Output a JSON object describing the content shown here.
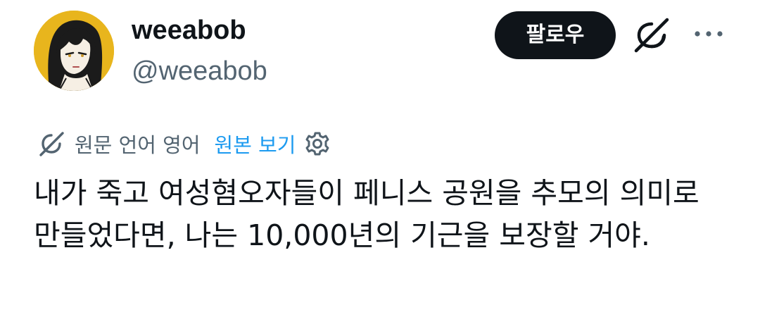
{
  "author": {
    "display_name": "weeabob",
    "handle": "@weeabob"
  },
  "actions": {
    "follow_label": "팔로우",
    "grok_icon": "grok-slash-icon",
    "more_icon": "more-horizontal-icon"
  },
  "translation": {
    "label": "원문 언어 영어",
    "view_original": "원본 보기",
    "translate_icon": "translate-icon",
    "settings_icon": "gear-icon"
  },
  "tweet": {
    "text": "내가 죽고 여성혐오자들이 페니스 공원을 추모의 의미로 만들었다면, 나는 10,000년의 기근을 보장할 거야."
  },
  "colors": {
    "text_primary": "#0f1419",
    "text_secondary": "#536471",
    "link": "#1d9bf0",
    "button_bg": "#0f1419",
    "avatar_bg": "#e8b51d"
  }
}
